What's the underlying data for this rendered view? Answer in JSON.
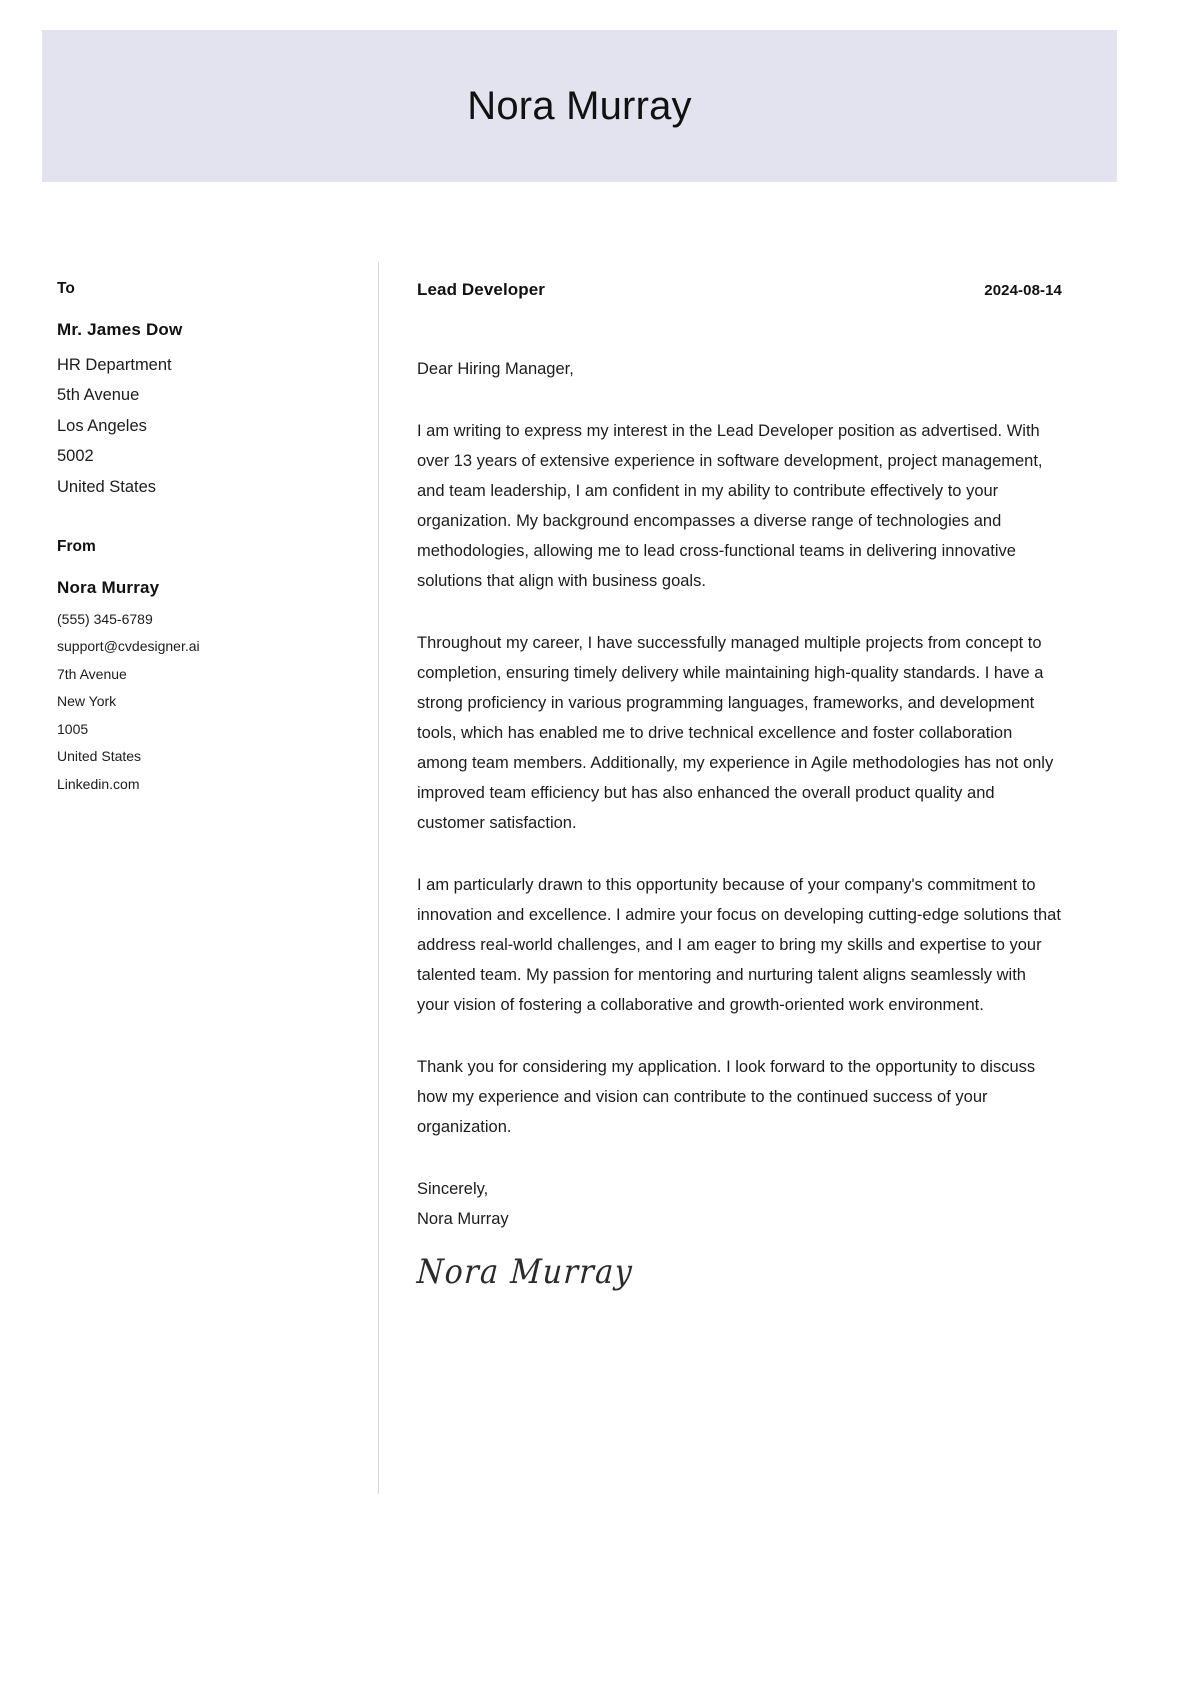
{
  "header": {
    "name": "Nora Murray"
  },
  "sidebar": {
    "to": {
      "heading": "To",
      "name": "Mr. James Dow",
      "lines": [
        "HR Department",
        "5th Avenue",
        "Los Angeles",
        "5002",
        "United States"
      ]
    },
    "from": {
      "heading": "From",
      "name": "Nora Murray",
      "lines": [
        "(555) 345-6789",
        "support@cvdesigner.ai",
        "7th Avenue",
        "New York",
        "1005",
        "United States",
        "Linkedin.com"
      ]
    }
  },
  "letter": {
    "job_title": "Lead Developer",
    "date": "2024-08-14",
    "salutation": "Dear Hiring Manager,",
    "paragraphs": [
      "I am writing to express my interest in the Lead Developer position as advertised. With over 13 years of extensive experience in software development, project management, and team leadership, I am confident in my ability to contribute effectively to your organization. My background encompasses a diverse range of technologies and methodologies, allowing me to lead cross-functional teams in delivering innovative solutions that align with business goals.",
      "Throughout my career, I have successfully managed multiple projects from concept to completion, ensuring timely delivery while maintaining high-quality standards. I have a strong proficiency in various programming languages, frameworks, and development tools, which has enabled me to drive technical excellence and foster collaboration among team members. Additionally, my experience in Agile methodologies has not only improved team efficiency but has also enhanced the overall product quality and customer satisfaction.",
      "I am particularly drawn to this opportunity because of your company's commitment to innovation and excellence. I admire your focus on developing cutting-edge solutions that address real-world challenges, and I am eager to bring my skills and expertise to your talented team. My passion for mentoring and nurturing talent aligns seamlessly with your vision of fostering a collaborative and growth-oriented work environment.",
      "Thank you for considering my application. I look forward to the opportunity to discuss how my experience and vision can contribute to the continued success of your organization."
    ],
    "closing": "Sincerely,",
    "closing_name": "Nora Murray",
    "signature": "Nora Murray"
  },
  "colors": {
    "header_background": "#e3e3f0",
    "text": "#1c1c1c",
    "divider": "#d6d6de"
  }
}
